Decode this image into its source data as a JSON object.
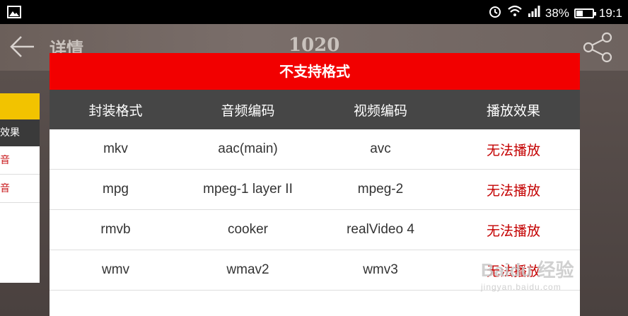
{
  "status_bar": {
    "battery_percent": "38%",
    "time": "19:1",
    "icons": [
      "image-icon",
      "alarm-icon",
      "wifi-icon",
      "signal-icon",
      "battery-icon"
    ]
  },
  "app_bar": {
    "title": "详情",
    "center_text": "1020",
    "back_icon": "back-arrow-icon",
    "share_icon": "share-icon"
  },
  "background_card": {
    "header_label": "效果",
    "rows": [
      "音",
      "音"
    ]
  },
  "dialog": {
    "title": "不支持格式",
    "columns": [
      "封装格式",
      "音频编码",
      "视频编码",
      "播放效果"
    ],
    "rows": [
      {
        "container": "mkv",
        "audio": "aac(main)",
        "video": "avc",
        "result": "无法播放"
      },
      {
        "container": "mpg",
        "audio": "mpeg-1 layer II",
        "video": "mpeg-2",
        "result": "无法播放"
      },
      {
        "container": "rmvb",
        "audio": "cooker",
        "video": "realVideo 4",
        "result": "无法播放"
      },
      {
        "container": "wmv",
        "audio": "wmav2",
        "video": "wmv3",
        "result": "无法播放"
      }
    ],
    "header_color": "#f20000",
    "result_color": "#c40000"
  },
  "watermark": {
    "brand": "Baidu 经验",
    "url": "jingyan.baidu.com"
  }
}
